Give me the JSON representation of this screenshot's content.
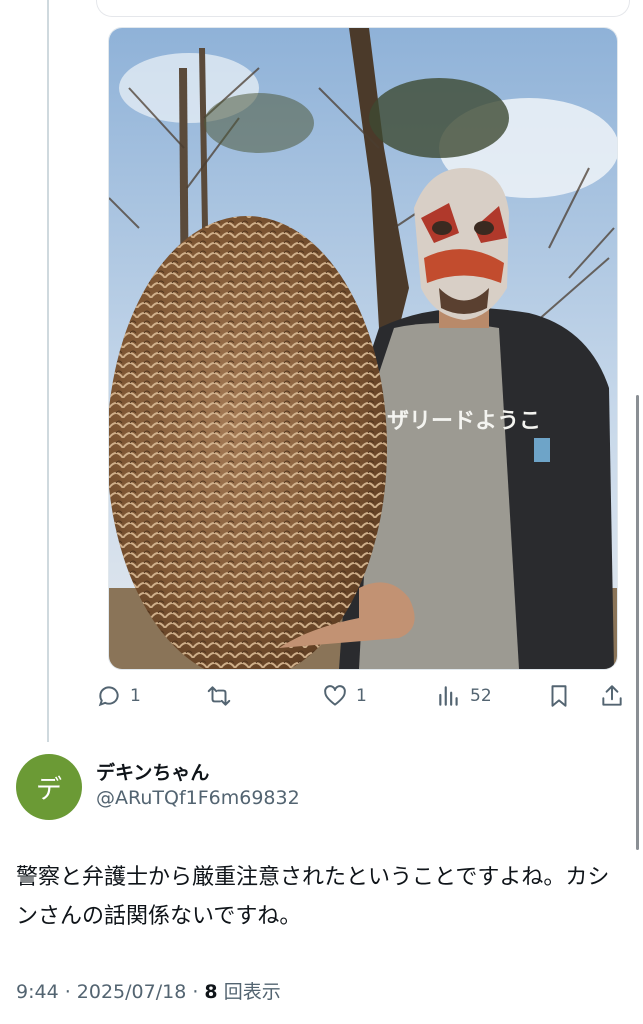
{
  "post": {
    "media": {
      "alt_icon": "photo",
      "shirt_text": "ザリードようこ"
    },
    "actions": {
      "reply_count": "1",
      "repost_count": "",
      "like_count": "1",
      "views_count": "52"
    }
  },
  "reply": {
    "avatar_char": "デ",
    "display_name": "デキンちゃん",
    "handle": "@ARuTQf1F6m69832",
    "text": "警察と弁護士から厳重注意されたということですよね。カシンさんの話関係ないですね。",
    "time": "9:44 · 2025/07/18 · ",
    "views_count": "8",
    "views_label": " 回表示"
  },
  "colors": {
    "accent_gray": "#536471",
    "avatar_green": "#6b9a35",
    "thread_line": "#cfd9de"
  }
}
